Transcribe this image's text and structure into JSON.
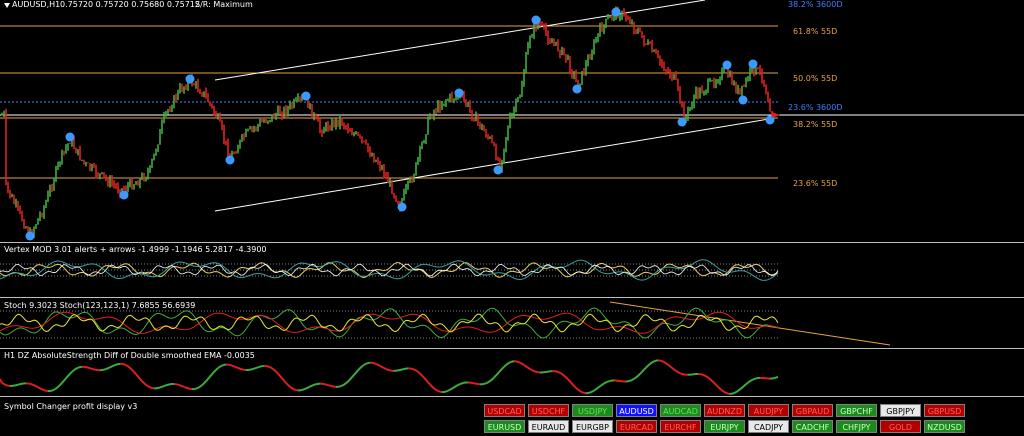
{
  "header": {
    "symbol": "AUDUSD,H1",
    "ohlc": "0.75720 0.75720 0.75680 0.75712",
    "mode": "S/R: Maximum"
  },
  "fib_labels": {
    "f382_top": "38.2% 3600D",
    "f618": "61.8% 55D",
    "f50": "50.0% 55D",
    "f236_blue": "23.6% 3600D",
    "f382": "38.2% 55D",
    "f236": "23.6% 55D"
  },
  "indicators": {
    "vertex": "Vertex MOD 3.01 alerts + arrows -1.4999 -1.1946 5.2817 -4.3900",
    "stoch": "Stoch 9.3023  Stoch(123,123,1) 7.6855 56.6939",
    "strength": "H1 DZ AbsoluteStrength Diff  of Double smoothed EMA -0.0035",
    "symbol_changer": "Symbol Changer profit display v3"
  },
  "colors": {
    "bull": "#3fae3f",
    "bear": "#e02020",
    "fib": "#e8a33c",
    "swing_dot": "#3a9aff",
    "channel": "#ffffff"
  },
  "symbol_buttons": {
    "row1": [
      {
        "label": "USDCAD",
        "bg": "#b00000",
        "fg": "#ff6060"
      },
      {
        "label": "USDCHF",
        "bg": "#b00000",
        "fg": "#ff6060"
      },
      {
        "label": "USDJPY",
        "bg": "#1e8a1e",
        "fg": "#60e060"
      },
      {
        "label": "AUDUSD",
        "bg": "#1010ff",
        "fg": "#ffffff"
      },
      {
        "label": "AUDCAD",
        "bg": "#1e8a1e",
        "fg": "#60e060"
      },
      {
        "label": "AUDNZD",
        "bg": "#b00000",
        "fg": "#ff6060"
      },
      {
        "label": "AUDJPY",
        "bg": "#b00000",
        "fg": "#ff6060"
      },
      {
        "label": "GBPAUD",
        "bg": "#b00000",
        "fg": "#ff6060"
      },
      {
        "label": "GBPCHF",
        "bg": "#1e8a1e",
        "fg": "#c8ffc8"
      },
      {
        "label": "GBPJPY",
        "bg": "#e8e8e8",
        "fg": "#000000"
      },
      {
        "label": "GBPUSD",
        "bg": "#b00000",
        "fg": "#ff6060"
      }
    ],
    "row2": [
      {
        "label": "EURUSD",
        "bg": "#1e8a1e",
        "fg": "#c8ffc8"
      },
      {
        "label": "EURAUD",
        "bg": "#e8e8e8",
        "fg": "#000000"
      },
      {
        "label": "EURGBP",
        "bg": "#e8e8e8",
        "fg": "#000000"
      },
      {
        "label": "EURCAD",
        "bg": "#b00000",
        "fg": "#ff6060"
      },
      {
        "label": "EURCHF",
        "bg": "#b00000",
        "fg": "#ff6060"
      },
      {
        "label": "EURJPY",
        "bg": "#1e8a1e",
        "fg": "#c8ffc8"
      },
      {
        "label": "CADJPY",
        "bg": "#e8e8e8",
        "fg": "#000000"
      },
      {
        "label": "CADCHF",
        "bg": "#1e8a1e",
        "fg": "#c8ffc8"
      },
      {
        "label": "CHFJPY",
        "bg": "#1e8a1e",
        "fg": "#c8ffc8"
      },
      {
        "label": "GOLD",
        "bg": "#b00000",
        "fg": "#ff6060"
      },
      {
        "label": "NZDUSD",
        "bg": "#1e8a1e",
        "fg": "#c8ffc8"
      }
    ]
  }
}
